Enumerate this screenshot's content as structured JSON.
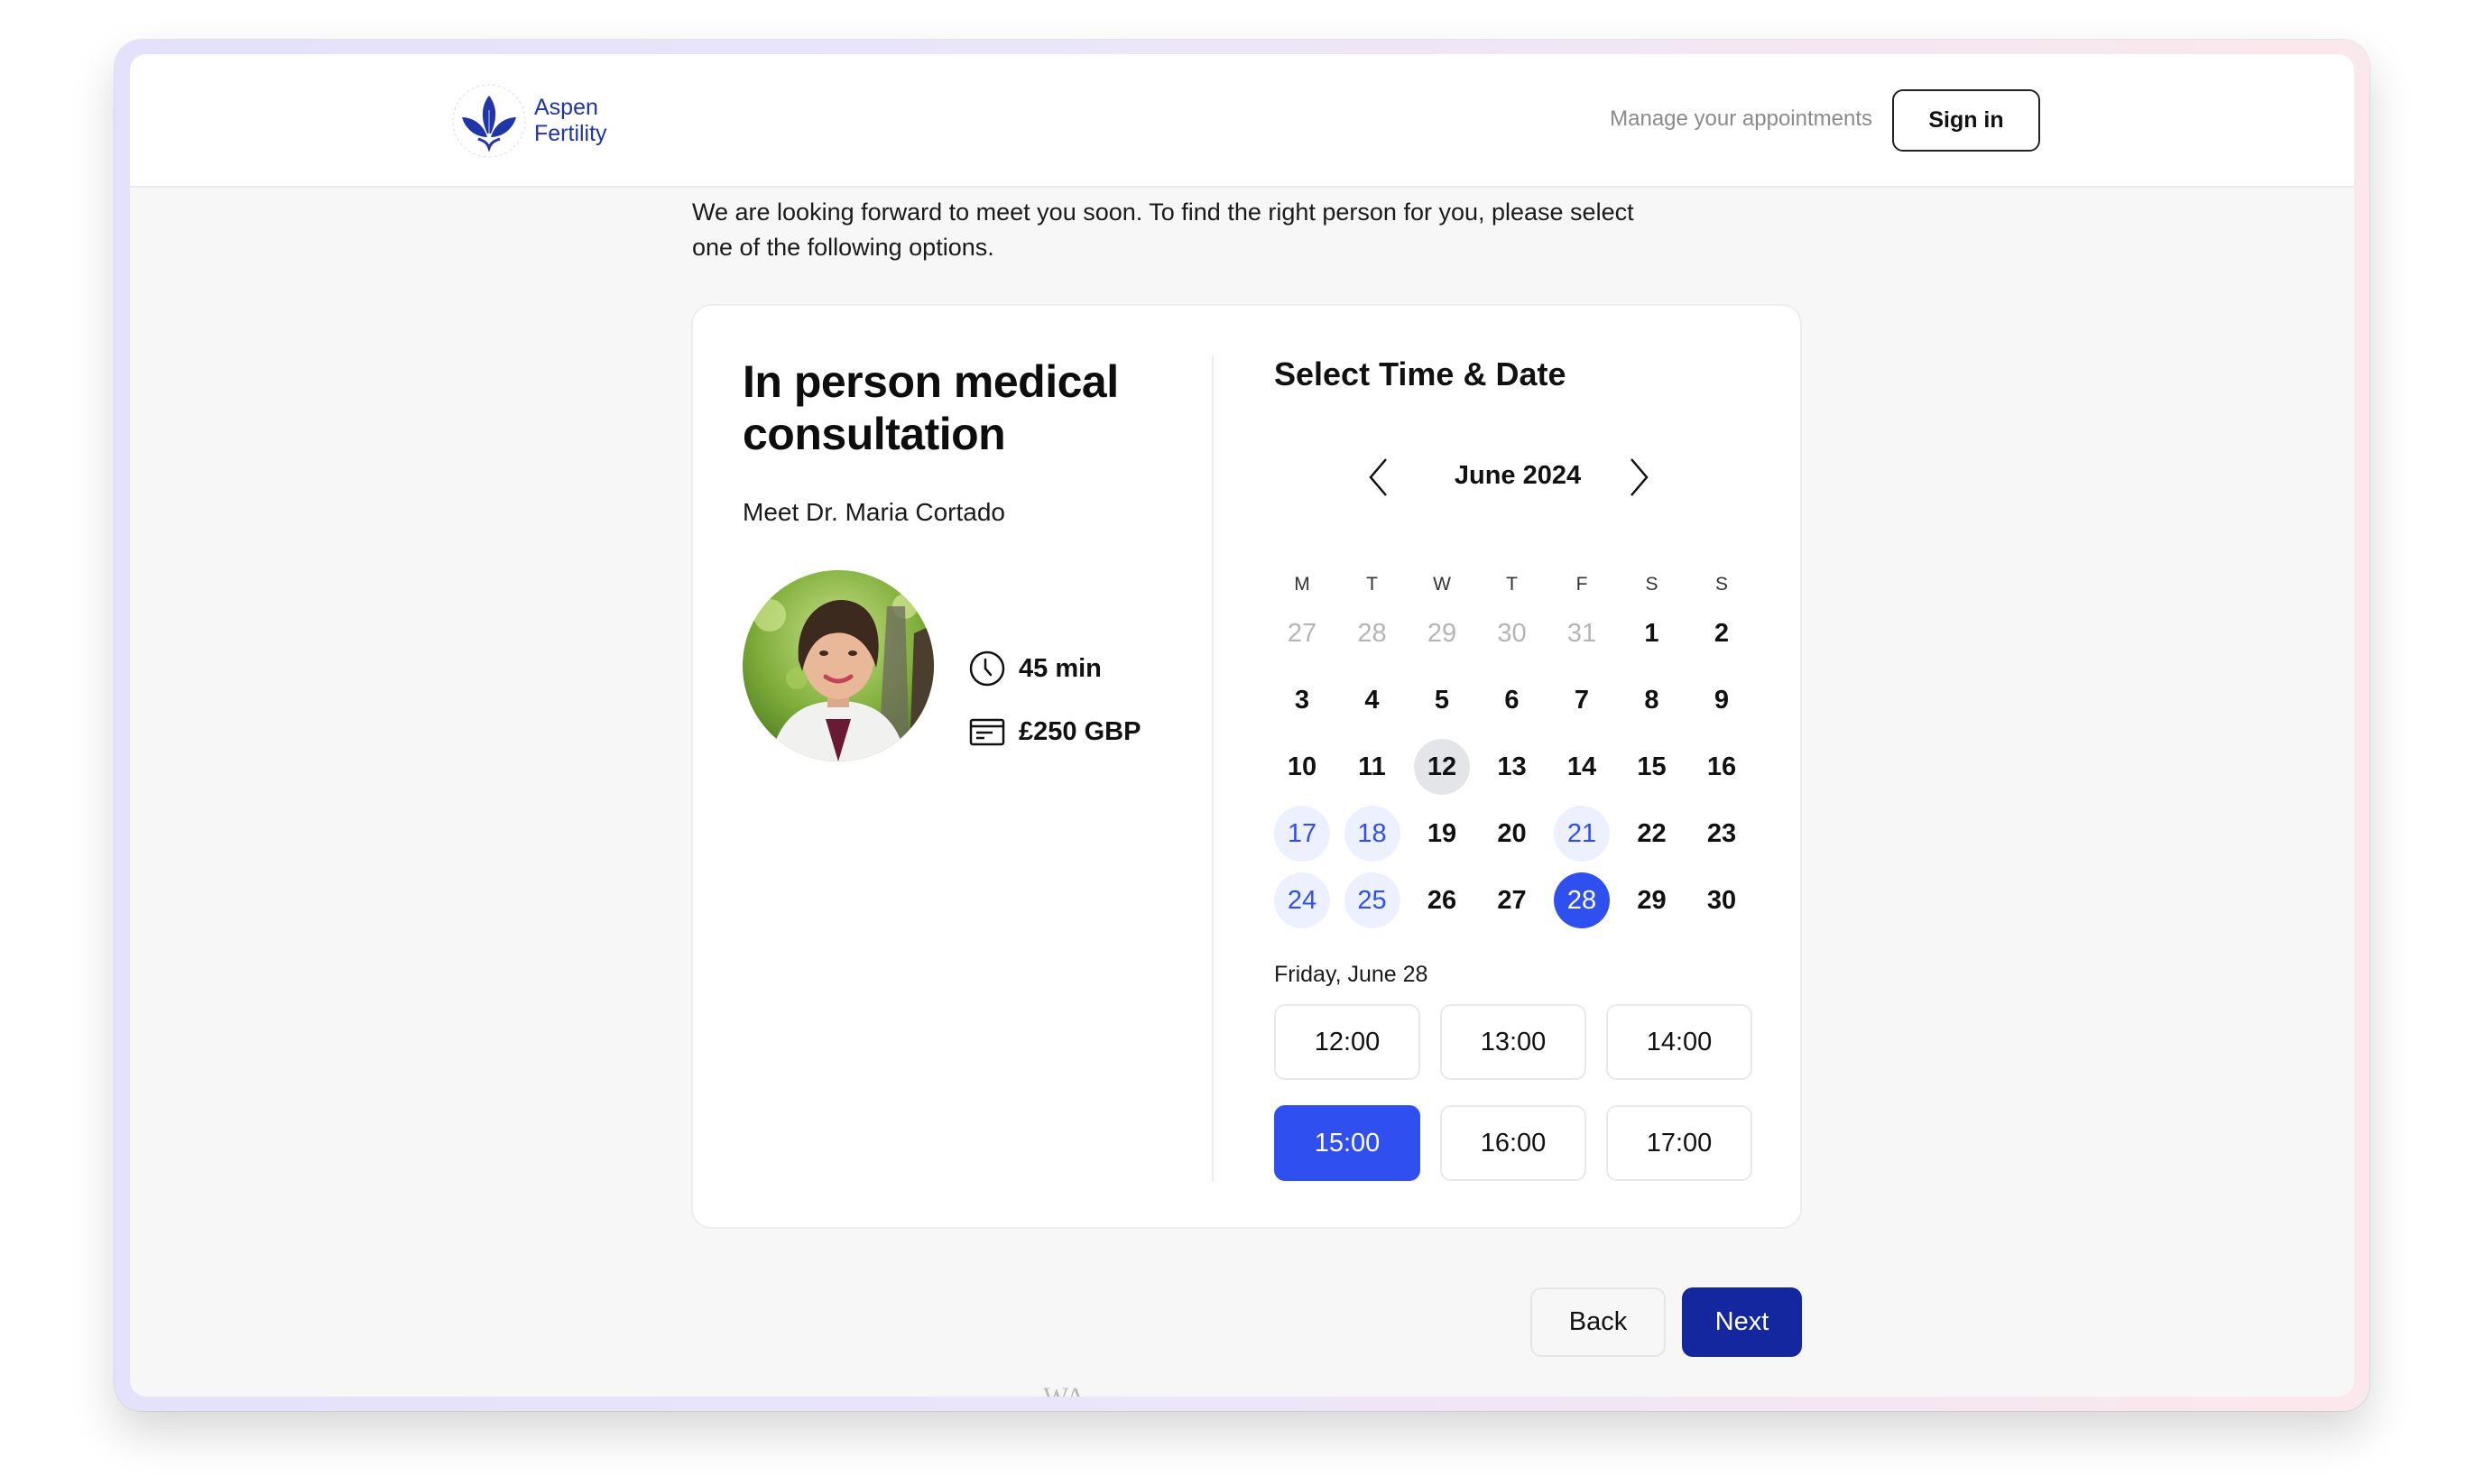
{
  "brand": {
    "name_line1": "Aspen",
    "name_line2": "Fertility",
    "logo_icon": "leaf-lotus-icon",
    "color": "#1f35a8"
  },
  "header": {
    "manage_link": "Manage your appointments",
    "sign_in_label": "Sign in"
  },
  "intro": {
    "text": "We are looking forward to meet you soon. To find the right person for you, please select one of the following options."
  },
  "consultation": {
    "title": "In person medical consultation",
    "doctor": "Meet Dr. Maria Cortado",
    "photo_alt": "Dr. Maria Cortado portrait",
    "duration": "45 min",
    "duration_icon": "clock-icon",
    "price": "£250 GBP",
    "price_icon": "credit-card-icon"
  },
  "scheduler": {
    "title": "Select Time & Date",
    "month_label": "June 2024",
    "prev_icon": "chevron-left-icon",
    "next_icon": "chevron-right-icon",
    "weekdays": [
      "M",
      "T",
      "W",
      "T",
      "F",
      "S",
      "S"
    ],
    "weeks": [
      [
        {
          "d": "27",
          "state": "muted"
        },
        {
          "d": "28",
          "state": "muted"
        },
        {
          "d": "29",
          "state": "muted"
        },
        {
          "d": "30",
          "state": "muted"
        },
        {
          "d": "31",
          "state": "muted"
        },
        {
          "d": "1",
          "state": "normal"
        },
        {
          "d": "2",
          "state": "normal"
        }
      ],
      [
        {
          "d": "3",
          "state": "normal"
        },
        {
          "d": "4",
          "state": "normal"
        },
        {
          "d": "5",
          "state": "normal"
        },
        {
          "d": "6",
          "state": "normal"
        },
        {
          "d": "7",
          "state": "normal"
        },
        {
          "d": "8",
          "state": "normal"
        },
        {
          "d": "9",
          "state": "normal"
        }
      ],
      [
        {
          "d": "10",
          "state": "normal"
        },
        {
          "d": "11",
          "state": "normal"
        },
        {
          "d": "12",
          "state": "today"
        },
        {
          "d": "13",
          "state": "normal"
        },
        {
          "d": "14",
          "state": "normal"
        },
        {
          "d": "15",
          "state": "normal"
        },
        {
          "d": "16",
          "state": "normal"
        }
      ],
      [
        {
          "d": "17",
          "state": "available"
        },
        {
          "d": "18",
          "state": "available"
        },
        {
          "d": "19",
          "state": "normal"
        },
        {
          "d": "20",
          "state": "normal"
        },
        {
          "d": "21",
          "state": "available"
        },
        {
          "d": "22",
          "state": "normal"
        },
        {
          "d": "23",
          "state": "normal"
        }
      ],
      [
        {
          "d": "24",
          "state": "available"
        },
        {
          "d": "25",
          "state": "available"
        },
        {
          "d": "26",
          "state": "normal"
        },
        {
          "d": "27",
          "state": "normal"
        },
        {
          "d": "28",
          "state": "selected"
        },
        {
          "d": "29",
          "state": "normal"
        },
        {
          "d": "30",
          "state": "normal"
        }
      ]
    ],
    "selected_date_label": "Friday, June 28",
    "time_slots": [
      {
        "time": "12:00",
        "selected": false
      },
      {
        "time": "13:00",
        "selected": false
      },
      {
        "time": "14:00",
        "selected": false
      },
      {
        "time": "15:00",
        "selected": true
      },
      {
        "time": "16:00",
        "selected": false
      },
      {
        "time": "17:00",
        "selected": false
      }
    ],
    "accent_color": "#2f4fef",
    "available_bg": "#edf1ff",
    "today_bg": "#e4e5e8"
  },
  "footer": {
    "back_label": "Back",
    "next_label": "Next",
    "next_color": "#15279e",
    "clipped_text": "WA"
  }
}
